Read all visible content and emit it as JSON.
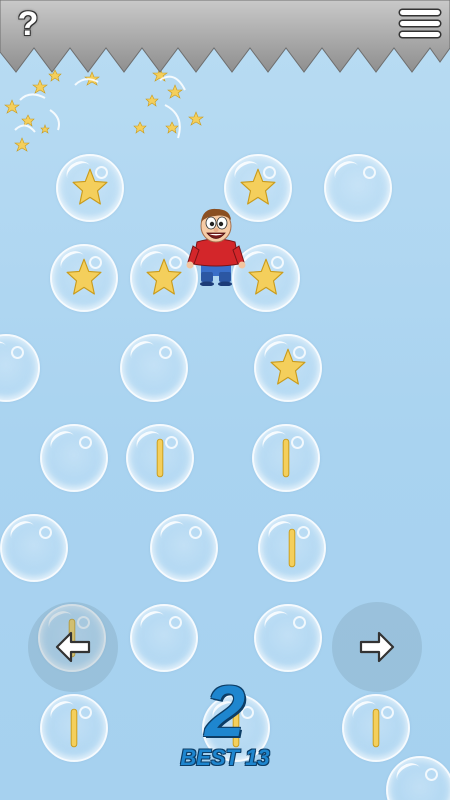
{
  "hud": {
    "help_label": "?",
    "menu_icon": "hamburger-menu-icon",
    "score": "2",
    "best_label": "BEST 13",
    "left_arrow_icon": "arrow-left-icon",
    "right_arrow_icon": "arrow-right-icon"
  },
  "colors": {
    "score_blue": "#1e86cf",
    "score_outline": "#0c3d66",
    "star_gold": "#f4cf5c",
    "sky": "#a9d3f0",
    "spikes": "#9a9a9a"
  },
  "bubbles": [
    {
      "content": "star"
    },
    {
      "content": "star"
    },
    {
      "content": "empty"
    },
    {
      "content": "star"
    },
    {
      "content": "star"
    },
    {
      "content": "star"
    },
    {
      "content": "empty"
    },
    {
      "content": "empty"
    },
    {
      "content": "star"
    },
    {
      "content": "empty"
    },
    {
      "content": "bar"
    },
    {
      "content": "bar"
    },
    {
      "content": "empty"
    },
    {
      "content": "empty"
    },
    {
      "content": "bar"
    },
    {
      "content": "bar"
    },
    {
      "content": "empty"
    },
    {
      "content": "empty"
    },
    {
      "content": "bar"
    },
    {
      "content": "bar"
    },
    {
      "content": "bar"
    },
    {
      "content": "empty"
    }
  ]
}
